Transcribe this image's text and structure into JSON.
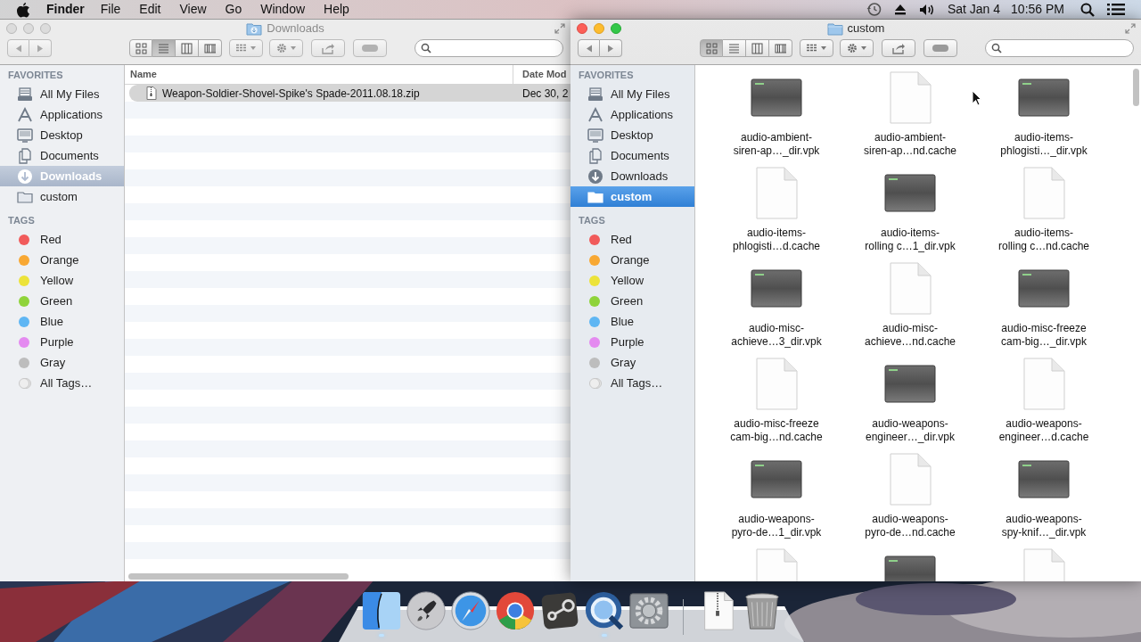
{
  "menubar": {
    "menus": [
      {
        "label": "Finder",
        "kind": "app"
      },
      {
        "label": "File",
        "kind": "menu"
      },
      {
        "label": "Edit",
        "kind": "menu"
      },
      {
        "label": "View",
        "kind": "menu"
      },
      {
        "label": "Go",
        "kind": "menu"
      },
      {
        "label": "Window",
        "kind": "menu"
      },
      {
        "label": "Help",
        "kind": "menu"
      }
    ],
    "date": "Sat Jan 4",
    "time": "10:56 PM"
  },
  "windows": [
    {
      "title": "Downloads",
      "title_icon": {
        "kind": "downloads"
      },
      "active": false,
      "view_modes": [
        {
          "kind": "icon",
          "selected": false
        },
        {
          "kind": "list",
          "selected": true
        },
        {
          "kind": "column",
          "selected": false
        },
        {
          "kind": "cover",
          "selected": false
        }
      ],
      "sidebar": [
        {
          "heading": "FAVORITES",
          "items": [
            {
              "label": "All My Files",
              "kind": "all-files",
              "selected": false
            },
            {
              "label": "Applications",
              "kind": "applications",
              "selected": false
            },
            {
              "label": "Desktop",
              "kind": "desktop",
              "selected": false
            },
            {
              "label": "Documents",
              "kind": "documents",
              "selected": false
            },
            {
              "label": "Downloads",
              "kind": "downloads",
              "selected": true
            },
            {
              "label": "custom",
              "kind": "folder",
              "selected": false
            }
          ]
        },
        {
          "heading": "TAGS",
          "items": [
            {
              "label": "Red",
              "kind": "tag",
              "color": "#f15b5b",
              "selected": false
            },
            {
              "label": "Orange",
              "kind": "tag",
              "color": "#f8a833",
              "selected": false
            },
            {
              "label": "Yellow",
              "kind": "tag",
              "color": "#ece33a",
              "selected": false
            },
            {
              "label": "Green",
              "kind": "tag",
              "color": "#8fd33a",
              "selected": false
            },
            {
              "label": "Blue",
              "kind": "tag",
              "color": "#5fb6f3",
              "selected": false
            },
            {
              "label": "Purple",
              "kind": "tag",
              "color": "#e48af0",
              "selected": false
            },
            {
              "label": "Gray",
              "kind": "tag",
              "color": "#bdbdbd",
              "selected": false
            },
            {
              "label": "All Tags…",
              "kind": "all-tags",
              "selected": false
            }
          ]
        }
      ],
      "list": {
        "columns": [
          "Name",
          "Date Mod"
        ],
        "rows": [
          {
            "name": "Weapon-Soldier-Shovel-Spike's Spade-2011.08.18.zip",
            "date": "Dec 30, 2",
            "kind": "zip",
            "selected": true
          }
        ]
      }
    },
    {
      "title": "custom",
      "title_icon": {
        "kind": "folder"
      },
      "active": true,
      "view_modes": [
        {
          "kind": "icon",
          "selected": true
        },
        {
          "kind": "list",
          "selected": false
        },
        {
          "kind": "column",
          "selected": false
        },
        {
          "kind": "cover",
          "selected": false
        }
      ],
      "sidebar": [
        {
          "heading": "FAVORITES",
          "items": [
            {
              "label": "All My Files",
              "kind": "all-files",
              "selected": false
            },
            {
              "label": "Applications",
              "kind": "applications",
              "selected": false
            },
            {
              "label": "Desktop",
              "kind": "desktop",
              "selected": false
            },
            {
              "label": "Documents",
              "kind": "documents",
              "selected": false
            },
            {
              "label": "Downloads",
              "kind": "downloads",
              "selected": false
            },
            {
              "label": "custom",
              "kind": "folder",
              "selected": true
            }
          ]
        },
        {
          "heading": "TAGS",
          "items": [
            {
              "label": "Red",
              "kind": "tag",
              "color": "#f15b5b",
              "selected": false
            },
            {
              "label": "Orange",
              "kind": "tag",
              "color": "#f8a833",
              "selected": false
            },
            {
              "label": "Yellow",
              "kind": "tag",
              "color": "#ece33a",
              "selected": false
            },
            {
              "label": "Green",
              "kind": "tag",
              "color": "#8fd33a",
              "selected": false
            },
            {
              "label": "Blue",
              "kind": "tag",
              "color": "#5fb6f3",
              "selected": false
            },
            {
              "label": "Purple",
              "kind": "tag",
              "color": "#e48af0",
              "selected": false
            },
            {
              "label": "Gray",
              "kind": "tag",
              "color": "#bdbdbd",
              "selected": false
            },
            {
              "label": "All Tags…",
              "kind": "all-tags",
              "selected": false
            }
          ]
        }
      ],
      "grid": [
        {
          "kind": "exec",
          "lines": [
            "audio-ambient-",
            "siren-ap…_dir.vpk"
          ],
          "selected": false
        },
        {
          "kind": "document",
          "lines": [
            "audio-ambient-",
            "siren-ap…nd.cache"
          ],
          "selected": false
        },
        {
          "kind": "exec",
          "lines": [
            "audio-items-",
            "phlogisti…_dir.vpk"
          ],
          "selected": false
        },
        {
          "kind": "document",
          "lines": [
            "audio-items-",
            "phlogisti…d.cache"
          ],
          "selected": false
        },
        {
          "kind": "exec",
          "lines": [
            "audio-items-",
            "rolling c…1_dir.vpk"
          ],
          "selected": false
        },
        {
          "kind": "document",
          "lines": [
            "audio-items-",
            "rolling c…nd.cache"
          ],
          "selected": false
        },
        {
          "kind": "exec",
          "lines": [
            "audio-misc-",
            "achieve…3_dir.vpk"
          ],
          "selected": false
        },
        {
          "kind": "document",
          "lines": [
            "audio-misc-",
            "achieve…nd.cache"
          ],
          "selected": false
        },
        {
          "kind": "exec",
          "lines": [
            "audio-misc-freeze",
            "cam-big…_dir.vpk"
          ],
          "selected": false
        },
        {
          "kind": "document",
          "lines": [
            "audio-misc-freeze",
            "cam-big…nd.cache"
          ],
          "selected": false
        },
        {
          "kind": "exec",
          "lines": [
            "audio-weapons-",
            "engineer…_dir.vpk"
          ],
          "selected": false
        },
        {
          "kind": "document",
          "lines": [
            "audio-weapons-",
            "engineer…d.cache"
          ],
          "selected": false
        },
        {
          "kind": "exec",
          "lines": [
            "audio-weapons-",
            "pyro-de…1_dir.vpk"
          ],
          "selected": false
        },
        {
          "kind": "document",
          "lines": [
            "audio-weapons-",
            "pyro-de…nd.cache"
          ],
          "selected": false
        },
        {
          "kind": "exec",
          "lines": [
            "audio-weapons-",
            "spy-knif…_dir.vpk"
          ],
          "selected": false
        },
        {
          "kind": "document",
          "selected": false
        },
        {
          "kind": "exec",
          "selected": false
        },
        {
          "kind": "document",
          "selected": false
        }
      ]
    }
  ],
  "dock": [
    {
      "kind": "finder",
      "running": true
    },
    {
      "kind": "rocket",
      "running": false
    },
    {
      "kind": "compass",
      "running": false
    },
    {
      "kind": "tricolor",
      "running": false
    },
    {
      "kind": "piston",
      "running": false
    },
    {
      "kind": "ring",
      "running": true
    },
    {
      "kind": "gear",
      "running": false
    },
    {
      "kind": "separator"
    },
    {
      "kind": "zip",
      "running": false
    },
    {
      "kind": "trash",
      "running": false
    }
  ]
}
